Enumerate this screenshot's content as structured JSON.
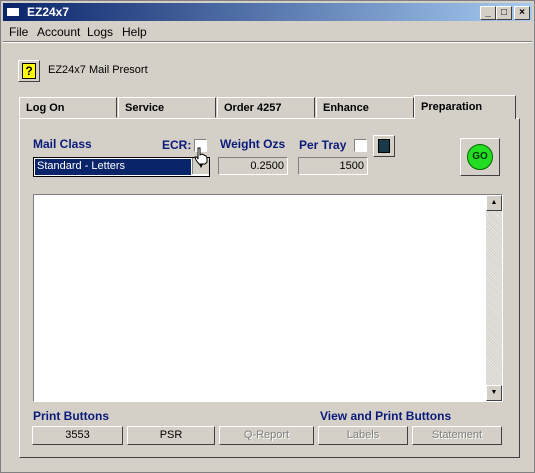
{
  "window": {
    "title": "EZ24x7"
  },
  "menu": [
    "File",
    "Account",
    "Logs",
    "Help"
  ],
  "app_title": "EZ24x7 Mail Presort",
  "tabs": [
    {
      "label": "Log On"
    },
    {
      "label": "Service"
    },
    {
      "label": "Order 4257"
    },
    {
      "label": "Enhance"
    },
    {
      "label": "Preparation"
    }
  ],
  "active_tab": "Preparation",
  "form": {
    "mail_class_label": "Mail Class",
    "mail_class_value": "Standard - Letters",
    "ecr_label": "ECR:",
    "ecr_checked": false,
    "weight_label": "Weight Ozs",
    "weight_value": "0.2500",
    "per_tray_label": "Per Tray",
    "per_tray_checked": false,
    "per_tray_value": "1500",
    "go_symbol": "GO"
  },
  "output_text": "",
  "print_buttons": {
    "label": "Print Buttons",
    "buttons": [
      {
        "label": "3553",
        "enabled": true
      },
      {
        "label": "PSR",
        "enabled": true
      }
    ]
  },
  "view_print_buttons": {
    "label": "View and Print Buttons",
    "buttons": [
      {
        "label": "Q-Report",
        "enabled": false
      },
      {
        "label": "Labels",
        "enabled": false
      },
      {
        "label": "Statement",
        "enabled": false
      }
    ]
  },
  "colors": {
    "label_blue": "#0a1a7a",
    "title_bar": "#0a246a",
    "go_green": "#22dd22"
  }
}
